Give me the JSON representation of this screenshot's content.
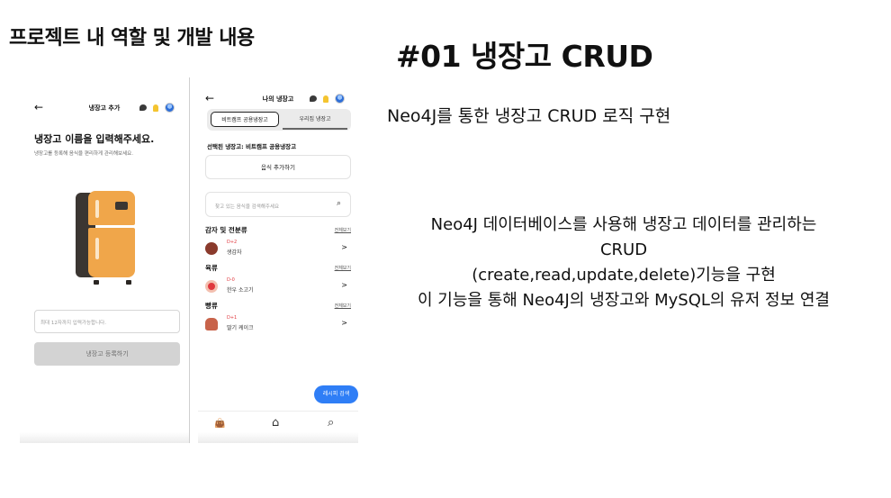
{
  "page": {
    "heading": "프로젝트 내 역할 및 개발 내용",
    "title": "#01 냉장고 CRUD",
    "summary": "Neo4J를 통한 냉장고 CRUD 로직 구현",
    "description": [
      "Neo4J 데이터베이스를 사용해 냉장고 데이터를 관리하는",
      "CRUD",
      "(create,read,update,delete)기능을 구현",
      "이 기능을 통해 Neo4J의 냉장고와 MySQL의 유저 정보 연결"
    ]
  },
  "phone1": {
    "back_icon": "←",
    "title": "냉장고 추가",
    "heading": "냉장고 이름을 입력해주세요.",
    "subtext": "냉장고를 등록해 음식을 편리하게 관리해보세요.",
    "input_placeholder": "최대 12자까지 입력가능합니다.",
    "register_button": "냉장고 등록하기",
    "icons": [
      "chat-icon",
      "bell-icon",
      "avatar"
    ]
  },
  "phone2": {
    "back_icon": "←",
    "title": "나의 냉장고",
    "tabs": [
      "비트캠프 공용냉장고",
      "우리집 냉장고"
    ],
    "selected_label": "선택된 냉장고: 비트캠프 공용냉장고",
    "add_food_button": "음식 추가하기",
    "search_placeholder": "찾고 있는 음식을 검색해주세요",
    "search_icon": "⌕",
    "see_all": "전체보기",
    "categories": [
      {
        "title": "감자 및 전분류",
        "item": {
          "dday": "D+2",
          "name": "생감자",
          "color": "#8a3a2c"
        }
      },
      {
        "title": "육류",
        "item": {
          "dday": "D-0",
          "name": "한우 소고기",
          "color": "#e0383e"
        }
      },
      {
        "title": "빵류",
        "item": {
          "dday": "D+1",
          "name": "딸기 케이크",
          "color": "#c8634a"
        }
      }
    ],
    "chevron": ">",
    "recipe_button": "레시피 검색",
    "nav": [
      "bag-icon",
      "home-icon",
      "search-icon"
    ],
    "nav_glyphs": [
      "👜",
      "⌂",
      "⌕"
    ]
  }
}
